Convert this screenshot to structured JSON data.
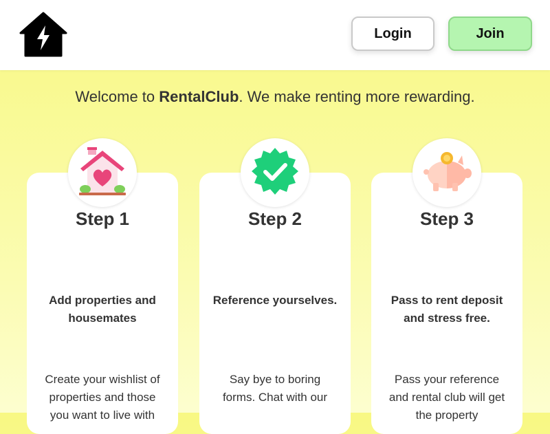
{
  "header": {
    "logo": "house-lightning-logo",
    "login_label": "Login",
    "join_label": "Join"
  },
  "welcome": {
    "prefix": "Welcome to ",
    "brand": "RentalClub",
    "suffix": ". We make renting more rewarding."
  },
  "steps": [
    {
      "icon": "house-heart-icon",
      "title": "Step 1",
      "subtitle": "Add properties and housemates",
      "description": "Create your wishlist of properties and those you want to live with"
    },
    {
      "icon": "verified-badge-icon",
      "title": "Step 2",
      "subtitle": "Reference yourselves.",
      "description": "Say bye to boring forms. Chat with our"
    },
    {
      "icon": "piggy-bank-icon",
      "title": "Step 3",
      "subtitle": "Pass to rent deposit and stress free.",
      "description": "Pass your reference and rental club will get the property"
    }
  ],
  "colors": {
    "background_top": "#f8f883",
    "join_button": "#b5f5b0",
    "badge_green": "#1ecf7a",
    "house_pink": "#e8457a",
    "piggy_pink": "#ffcfc0",
    "coin_gold": "#f5b82e"
  }
}
